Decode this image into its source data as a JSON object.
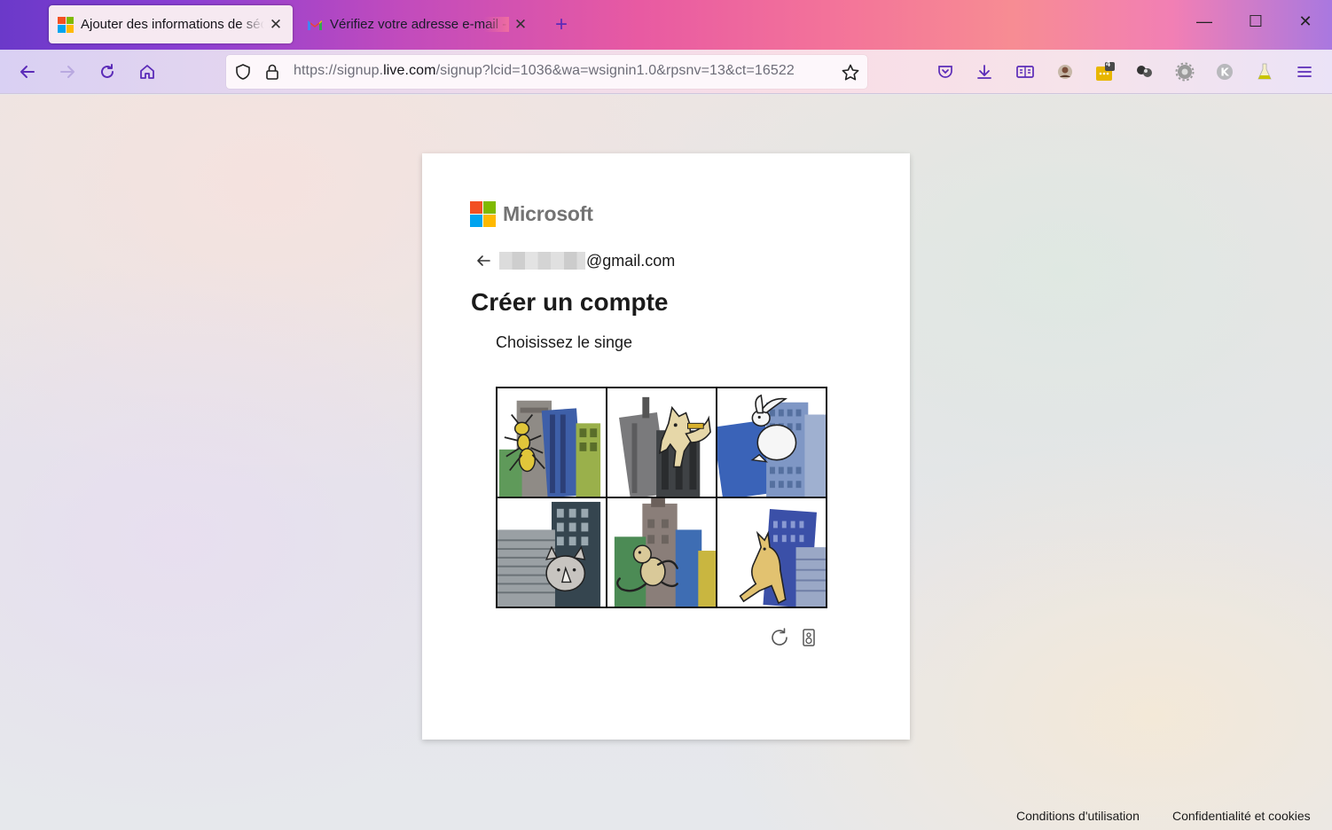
{
  "browser": {
    "tabs": [
      {
        "title": "Ajouter des informations de sécurité",
        "active": true,
        "icon": "microsoft-icon"
      },
      {
        "title": "Vérifiez votre adresse e-mail - boîte",
        "active": false,
        "icon": "gmail-icon"
      }
    ],
    "url": {
      "prefix": "https://signup.",
      "domain": "live.com",
      "path": "/signup?lcid=1036&wa=wsignin1.0&rpsnv=13&ct=16522"
    },
    "extension_badge": "4"
  },
  "page": {
    "brand": "Microsoft",
    "email_suffix": "@gmail.com",
    "title": "Créer un compte",
    "instruction": "Choisissez le singe",
    "captcha_tiles": [
      {
        "animal": "ant"
      },
      {
        "animal": "dog"
      },
      {
        "animal": "rabbit"
      },
      {
        "animal": "rhino"
      },
      {
        "animal": "monkey"
      },
      {
        "animal": "kangaroo"
      }
    ],
    "footer": {
      "terms": "Conditions d'utilisation",
      "privacy": "Confidentialité et cookies"
    }
  },
  "colors": {
    "ms_red": "#f25022",
    "ms_green": "#7fba00",
    "ms_blue": "#00a4ef",
    "ms_yellow": "#ffb900"
  }
}
